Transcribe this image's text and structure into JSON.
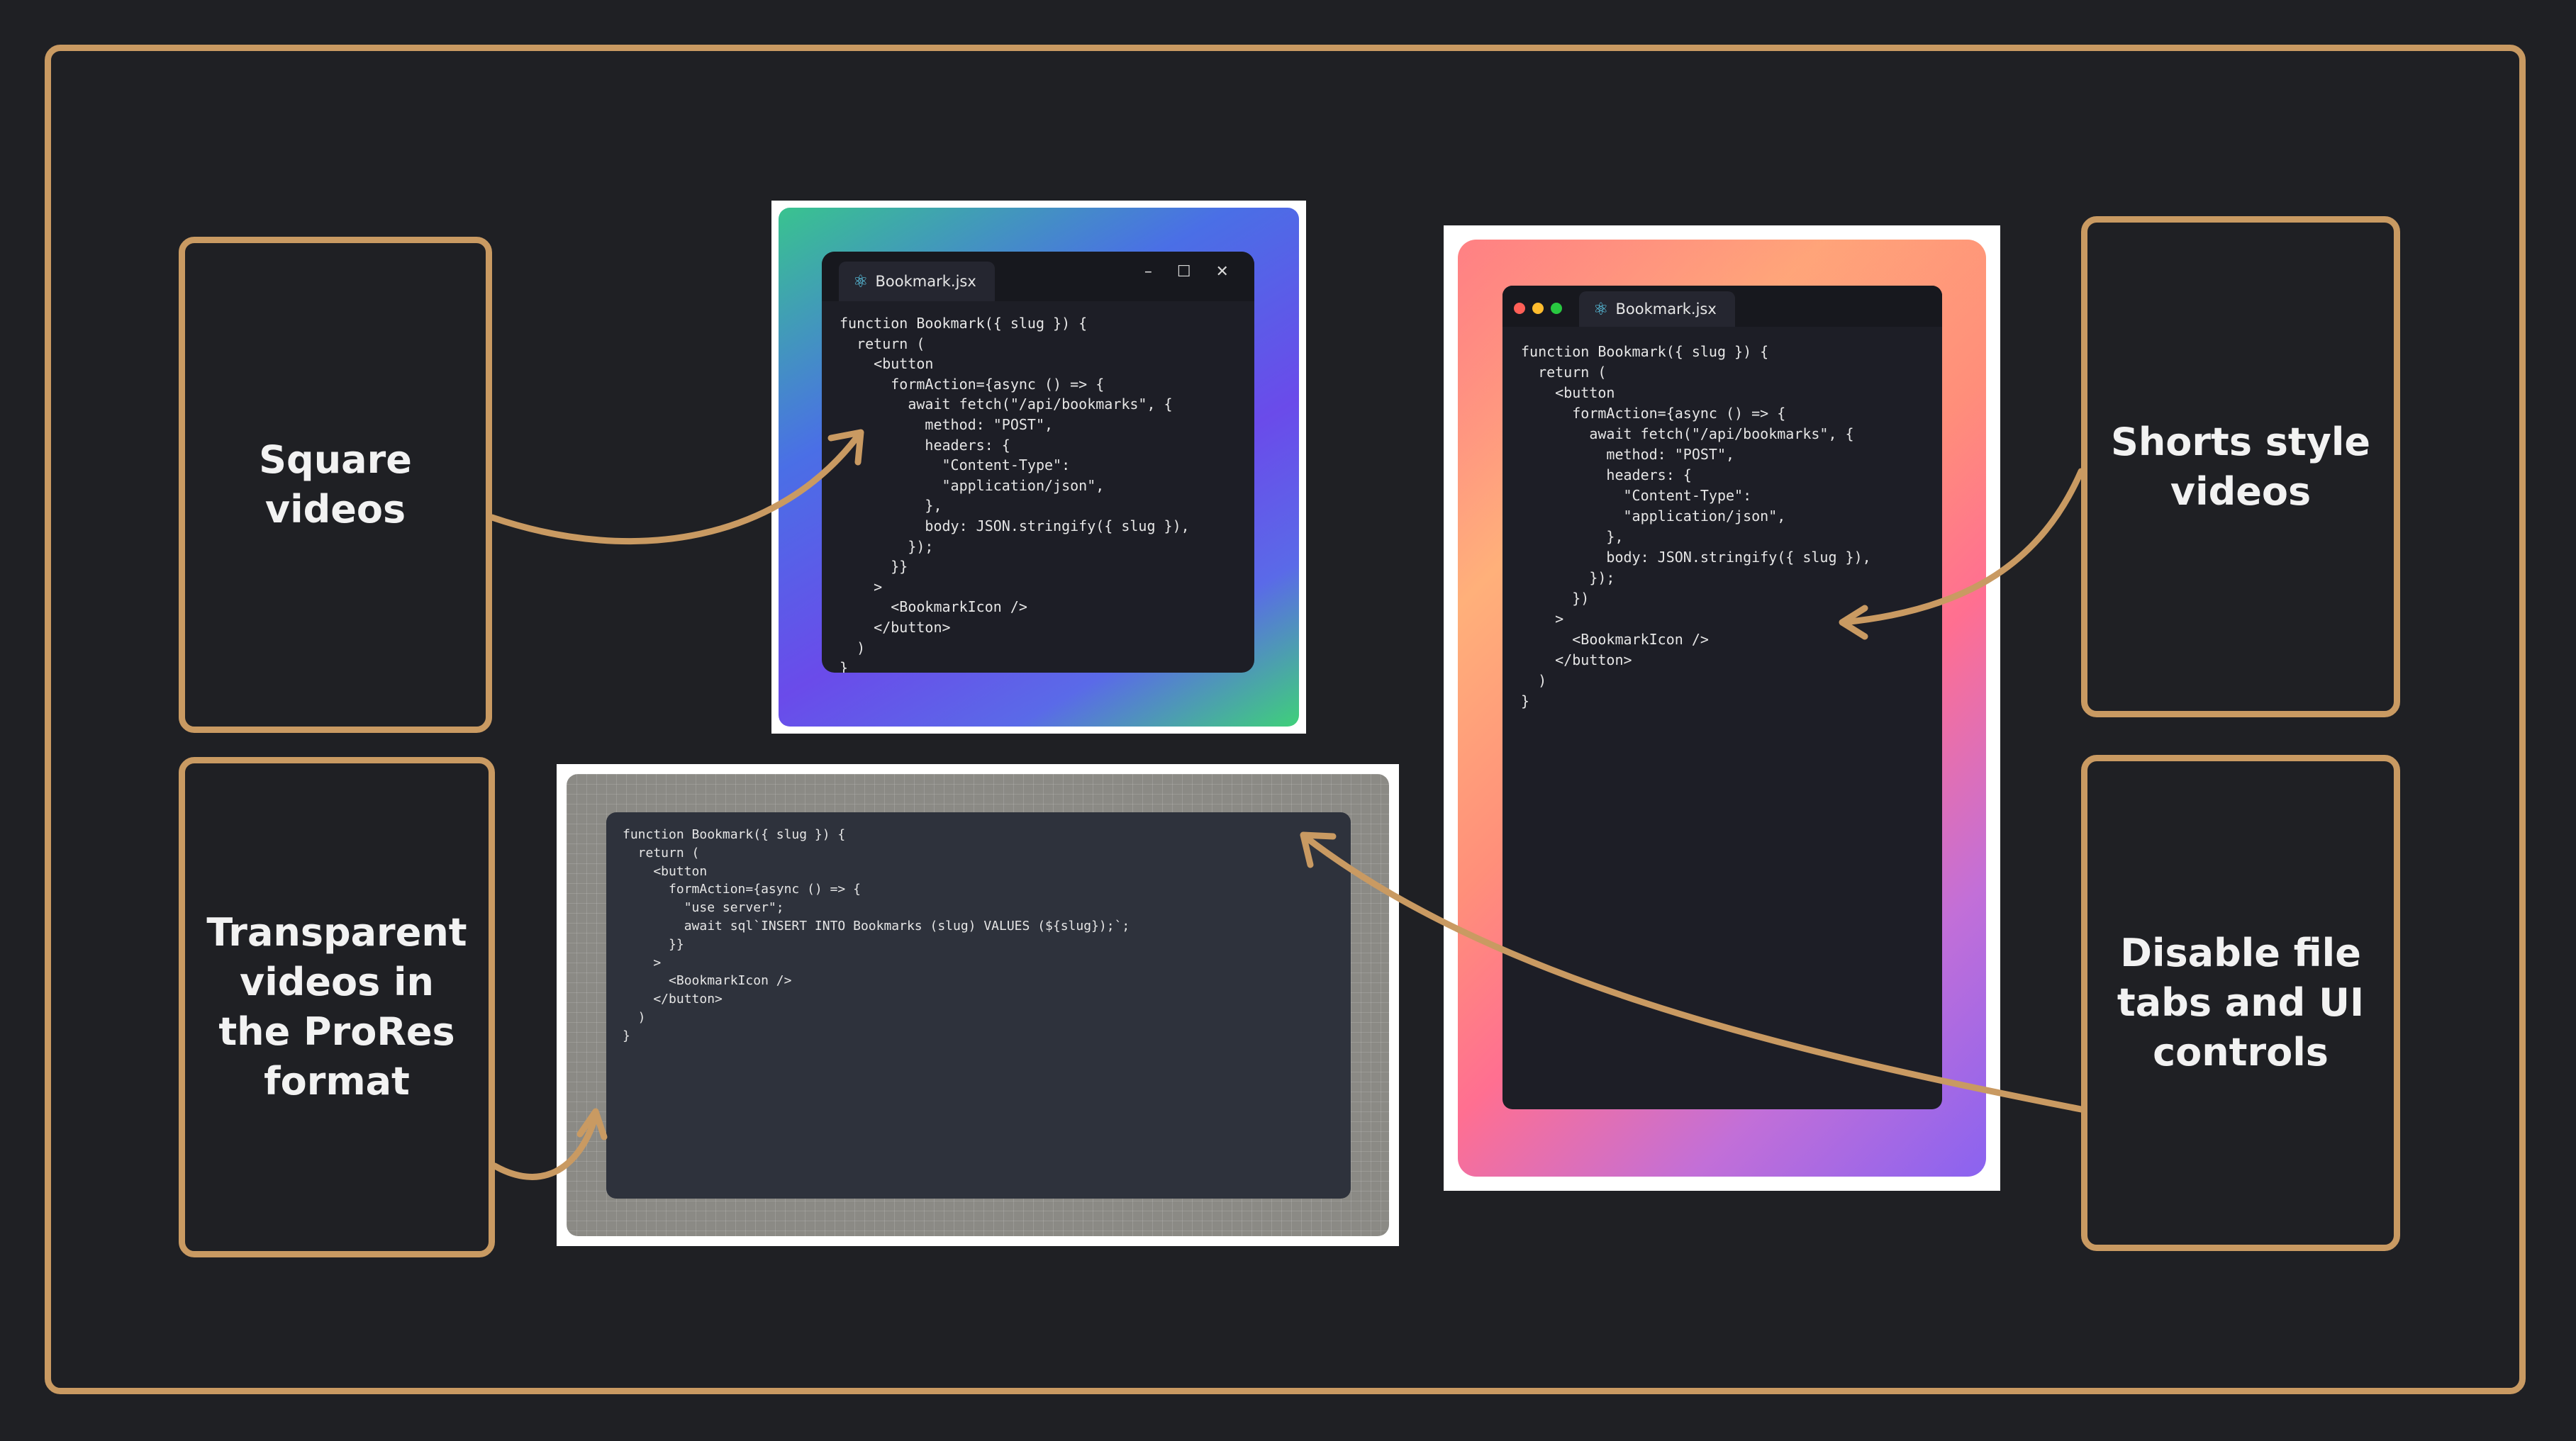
{
  "callouts": {
    "square": "Square videos",
    "transparent": "Transparent videos in the ProRes format",
    "shorts": "Shorts style videos",
    "disable": "Disable file tabs and UI controls"
  },
  "tab_filename": "Bookmark.jsx",
  "window_controls": "– ☐ ✕",
  "colors": {
    "accent": "#c99a62",
    "background": "#1f2024",
    "dot_red": "#ff5f57",
    "dot_yellow": "#febc2e",
    "dot_green": "#28c840"
  },
  "code_square": "function Bookmark({ slug }) {\n  return (\n    <button\n      formAction={async () => {\n        await fetch(\"/api/bookmarks\", {\n          method: \"POST\",\n          headers: {\n            \"Content-Type\":\n            \"application/json\",\n          },\n          body: JSON.stringify({ slug }),\n        });\n      }}\n    >\n      <BookmarkIcon />\n    </button>\n  )\n}",
  "code_shorts": "function Bookmark({ slug }) {\n  return (\n    <button\n      formAction={async () => {\n        await fetch(\"/api/bookmarks\", {\n          method: \"POST\",\n          headers: {\n            \"Content-Type\":\n            \"application/json\",\n          },\n          body: JSON.stringify({ slug }),\n        });\n      })\n    >\n      <BookmarkIcon />\n    </button>\n  )\n}",
  "code_transparent": "function Bookmark({ slug }) {\n  return (\n    <button\n      formAction={async () => {\n        \"use server\";\n        await sql`INSERT INTO Bookmarks (slug) VALUES (${slug});`;\n      }}\n    >\n      <BookmarkIcon />\n    </button>\n  )\n}"
}
